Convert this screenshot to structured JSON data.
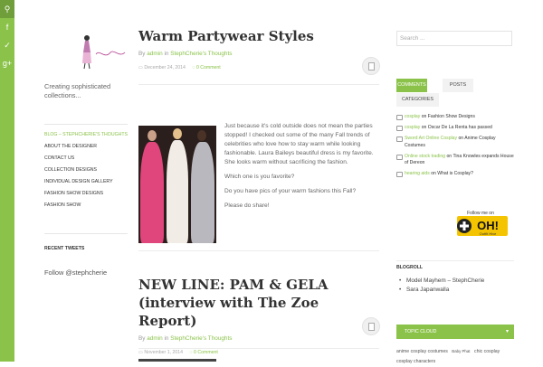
{
  "social": [
    {
      "icon": "search-icon",
      "glyph": "⚲"
    },
    {
      "icon": "facebook-icon",
      "glyph": "f"
    },
    {
      "icon": "twitter-icon",
      "glyph": "✓"
    },
    {
      "icon": "google-plus-icon",
      "glyph": "g+"
    }
  ],
  "site": {
    "tagline": "Creating sophisticated collections..."
  },
  "nav": [
    {
      "label": "BLOG – STEPHCHERIE'S THOUGHTS",
      "active": true
    },
    {
      "label": "ABOUT THE DESIGNER",
      "active": false
    },
    {
      "label": "CONTACT US",
      "active": false
    },
    {
      "label": "COLLECTION DESIGNS",
      "active": false
    },
    {
      "label": "INDIVIDUAL DESIGN GALLERY",
      "active": false
    },
    {
      "label": "FASHION SHOW DESIGNS",
      "active": false
    },
    {
      "label": "FASHION SHOW",
      "active": false
    }
  ],
  "recent_tweets": {
    "title": "RECENT TWEETS",
    "follow": "Follow @stephcherie"
  },
  "posts": [
    {
      "title": "Warm Partywear Styles",
      "by": "By",
      "author": "admin",
      "in": "in",
      "category": "StephCherie's Thoughts",
      "date": "December 24, 2014",
      "comments": "0 Comment",
      "paragraphs": [
        "Just because it's cold outside does not mean the parties stopped! I checked out some of the many Fall trends of celebrities who love how to stay warm while looking fashionable. Laura Baileys beautiful dress is my favorite. She looks warm without sacrificing the fashion.",
        "Which one is you favorite?",
        "Do you have pics of your warm fashions this Fall?",
        "Please do share!"
      ]
    },
    {
      "title": "NEW LINE: PAM & GELA (interview with The Zoe Report)",
      "by": "By",
      "author": "admin",
      "in": "in",
      "category": "StephCherie's Thoughts",
      "date": "November 1, 2014",
      "comments": "0 Comment"
    }
  ],
  "sidebar": {
    "search_placeholder": "Search ...",
    "tabs": [
      {
        "label": "COMMENTS",
        "active": true
      },
      {
        "label": "POSTS",
        "active": false
      },
      {
        "label": "CATEGORIES",
        "active": false
      }
    ],
    "recent_comments": [
      {
        "author": "cosplay",
        "on": "on",
        "post": "Fashion Show Designs"
      },
      {
        "author": "cosplay",
        "on": "on",
        "post": "Oscar De La Renta has passed"
      },
      {
        "author": "Sword Art Online Cosplay",
        "on": "on",
        "post": "Anime Cosplay Costumes"
      },
      {
        "author": "Online stock trading",
        "on": "on",
        "post": "Tina Knowles expands House of Dereon"
      },
      {
        "author": "hearing aids",
        "on": "on",
        "post": "What is Cosplay?"
      }
    ],
    "badge": {
      "top": "Follow me on",
      "big": "OH!",
      "sub": "Outfit Hive"
    },
    "blogroll_title": "BLOGROLL",
    "blogroll": [
      "Model Mayhem – StephCherie",
      "Sara Japanwalla"
    ],
    "topic_cloud": "TOPIC CLOUD",
    "tags": [
      "anime cosplay costumes",
      "Baby Phat",
      "chic cosplay",
      "cosplay characters"
    ]
  },
  "colors": {
    "accent": "#8bc34a",
    "accent_dark": "#6f9e3a"
  }
}
